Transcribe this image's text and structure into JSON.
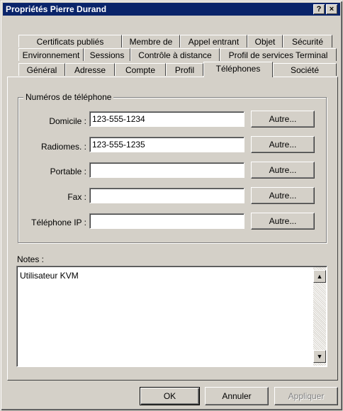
{
  "window": {
    "title": "Propriétés Pierre Durand",
    "help_label": "?",
    "close_label": "×"
  },
  "tabs": {
    "row1": [
      "Certificats publiés",
      "Membre de",
      "Appel entrant",
      "Objet",
      "Sécurité"
    ],
    "row2": [
      "Environnement",
      "Sessions",
      "Contrôle à distance",
      "Profil de services Terminal"
    ],
    "row3": [
      "Général",
      "Adresse",
      "Compte",
      "Profil",
      "Téléphones",
      "Société"
    ],
    "active": "Téléphones"
  },
  "phones": {
    "group_title": "Numéros de téléphone",
    "fields": [
      {
        "label": "Domicile :",
        "value": "123-555-1234",
        "button": "Autre..."
      },
      {
        "label": "Radiomes. :",
        "value": "123-555-1235",
        "button": "Autre..."
      },
      {
        "label": "Portable :",
        "value": "",
        "button": "Autre..."
      },
      {
        "label": "Fax :",
        "value": "",
        "button": "Autre..."
      },
      {
        "label": "Téléphone IP :",
        "value": "",
        "button": "Autre..."
      }
    ]
  },
  "notes": {
    "label": "Notes :",
    "value": "Utilisateur KVM"
  },
  "footer": {
    "ok_label": "OK",
    "cancel_label": "Annuler",
    "apply_label": "Appliquer"
  }
}
